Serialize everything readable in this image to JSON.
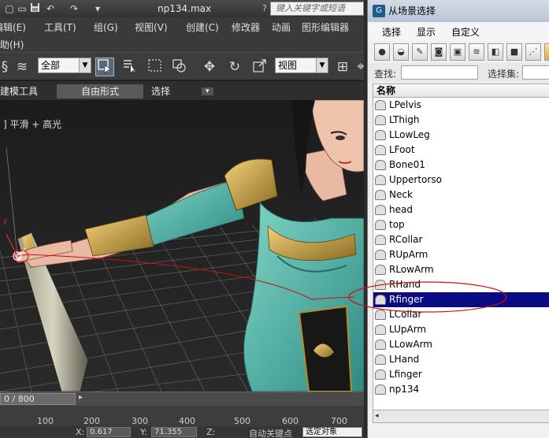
{
  "max": {
    "title": "np134.max",
    "search_placeholder": "键入关键字或短语",
    "help_glyph": "?",
    "quick_access": [
      "▢",
      "▭",
      "💾",
      "↶",
      "↷",
      "▾"
    ],
    "menus": [
      "编辑(E)",
      "工具(T)",
      "组(G)",
      "视图(V)",
      "创建(C)",
      "修改器",
      "动画",
      "图形编辑器",
      "帮助(H)"
    ],
    "selection_filter": "全部",
    "ref_coord": "视图",
    "ribbon_tabs": [
      "建模工具",
      "自由形式",
      "选择"
    ],
    "ribbon_tab_extra": "▾",
    "viewport_label": "] 平滑 + 高光",
    "axis_labels": [
      "y",
      "x",
      "z"
    ],
    "time_slider": "0 / 800",
    "ruler_ticks": [
      "100",
      "200",
      "300",
      "400",
      "500",
      "600",
      "700"
    ],
    "status": {
      "x_label": "X:",
      "x_value": "0.617",
      "y_label": "Y:",
      "y_value": "71.355",
      "z_label": "Z:",
      "autokey_label": "自动关键点",
      "set_key_field": "选定对象"
    }
  },
  "dialog": {
    "title": "从场景选择",
    "app_icon": "G",
    "menus": [
      "选择",
      "显示",
      "自定义"
    ],
    "find_label": "查找:",
    "selection_set_label": "选择集:",
    "column_header": "名称",
    "items": [
      "LPelvis",
      "LThigh",
      "LLowLeg",
      "LFoot",
      "Bone01",
      "Uppertorso",
      "Neck",
      "head",
      "top",
      "RCollar",
      "RUpArm",
      "RLowArm",
      "RHand",
      "Rfinger",
      "LCollar",
      "LUpArm",
      "LLowArm",
      "LHand",
      "Lfinger",
      "np134"
    ],
    "selected": "Rfinger",
    "scroll_left": "◂"
  },
  "colors": {
    "selection_highlight": "#0a0a82",
    "annotation_red": "#cc1111"
  }
}
